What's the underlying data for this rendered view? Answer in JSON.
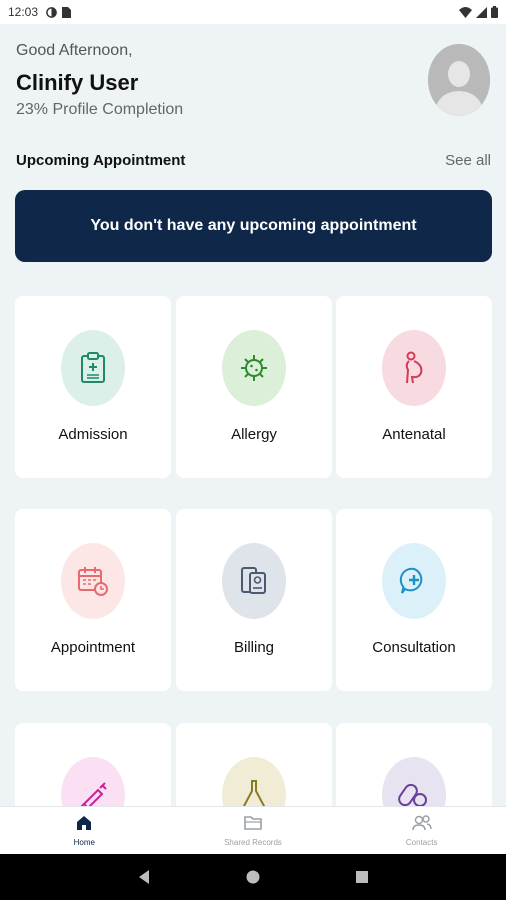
{
  "status_bar": {
    "time": "12:03"
  },
  "header": {
    "greeting": "Good Afternoon,",
    "user_name": "Clinify User",
    "profile_completion": "23% Profile Completion"
  },
  "appointments": {
    "title": "Upcoming Appointment",
    "see_all_label": "See all",
    "empty_message": "You don't have any upcoming appointment"
  },
  "tiles": [
    {
      "label": "Admission",
      "icon": "clipboard-icon",
      "bg": "#dcefe8",
      "color": "#1f8a6a"
    },
    {
      "label": "Allergy",
      "icon": "virus-icon",
      "bg": "#dcefd8",
      "color": "#2e8a2e"
    },
    {
      "label": "Antenatal",
      "icon": "pregnant-icon",
      "bg": "#f7dbe0",
      "color": "#d23a55"
    },
    {
      "label": "Appointment",
      "icon": "calendar-clock-icon",
      "bg": "#fde6e6",
      "color": "#e8696f"
    },
    {
      "label": "Billing",
      "icon": "billing-icon",
      "bg": "#dfe3ea",
      "color": "#4b5a70"
    },
    {
      "label": "Consultation",
      "icon": "chat-medical-icon",
      "bg": "#dcf0fa",
      "color": "#1f8fc7"
    },
    {
      "label": "",
      "icon": "syringe-icon",
      "bg": "#fbe0f3",
      "color": "#c4239a"
    },
    {
      "label": "",
      "icon": "flask-icon",
      "bg": "#f1ecd6",
      "color": "#8a7a22"
    },
    {
      "label": "",
      "icon": "pills-icon",
      "bg": "#e8e3f1",
      "color": "#6a3f9a"
    }
  ],
  "bottom_nav": [
    {
      "label": "Home",
      "icon": "home-icon",
      "active": true
    },
    {
      "label": "Shared Records",
      "icon": "folder-icon",
      "active": false
    },
    {
      "label": "Contacts",
      "icon": "contacts-icon",
      "active": false
    }
  ],
  "colors": {
    "navy": "#0f2748",
    "background": "#eef3f5"
  }
}
